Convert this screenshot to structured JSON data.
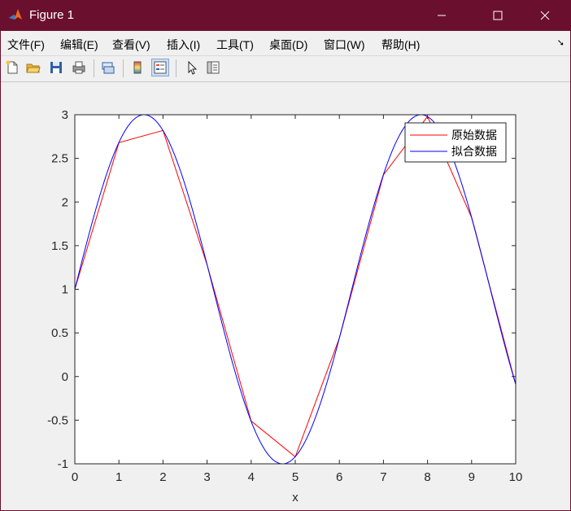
{
  "window": {
    "title": "Figure 1"
  },
  "menu": [
    "文件(F)",
    "编辑(E)",
    "查看(V)",
    "插入(I)",
    "工具(T)",
    "桌面(D)",
    "窗口(W)",
    "帮助(H)"
  ],
  "toolbar": {
    "icons": [
      "new-figure-icon",
      "open-file-icon",
      "save-icon",
      "print-icon",
      "link-plot-icon",
      "insert-colorbar-icon",
      "insert-legend-icon",
      "pointer-icon",
      "property-inspector-icon"
    ]
  },
  "colors": {
    "titlebar": "#6b0f2e",
    "original": "#ff0000",
    "fitted": "#0000ff"
  },
  "chart_data": {
    "type": "line",
    "title": "",
    "xlabel": "x",
    "ylabel": "",
    "xlim": [
      0,
      10
    ],
    "ylim": [
      -1,
      3
    ],
    "xticks": [
      0,
      1,
      2,
      3,
      4,
      5,
      6,
      7,
      8,
      9,
      10
    ],
    "yticks": [
      -1,
      -0.5,
      0,
      0.5,
      1,
      1.5,
      2,
      2.5,
      3
    ],
    "legend_position": "top-right",
    "grid": false,
    "series": [
      {
        "name": "原始数据",
        "color": "#ff0000",
        "x": [
          0,
          1,
          2,
          3,
          4,
          5,
          6,
          7,
          8,
          9,
          10
        ],
        "y": [
          1.0,
          2.68,
          2.82,
          1.28,
          -0.51,
          -0.92,
          0.44,
          2.31,
          2.98,
          1.82,
          -0.09
        ]
      },
      {
        "name": "拟合数据",
        "color": "#0000ff",
        "function": "1 + 2*sin(x)",
        "x_range": [
          0,
          10
        ]
      }
    ]
  }
}
